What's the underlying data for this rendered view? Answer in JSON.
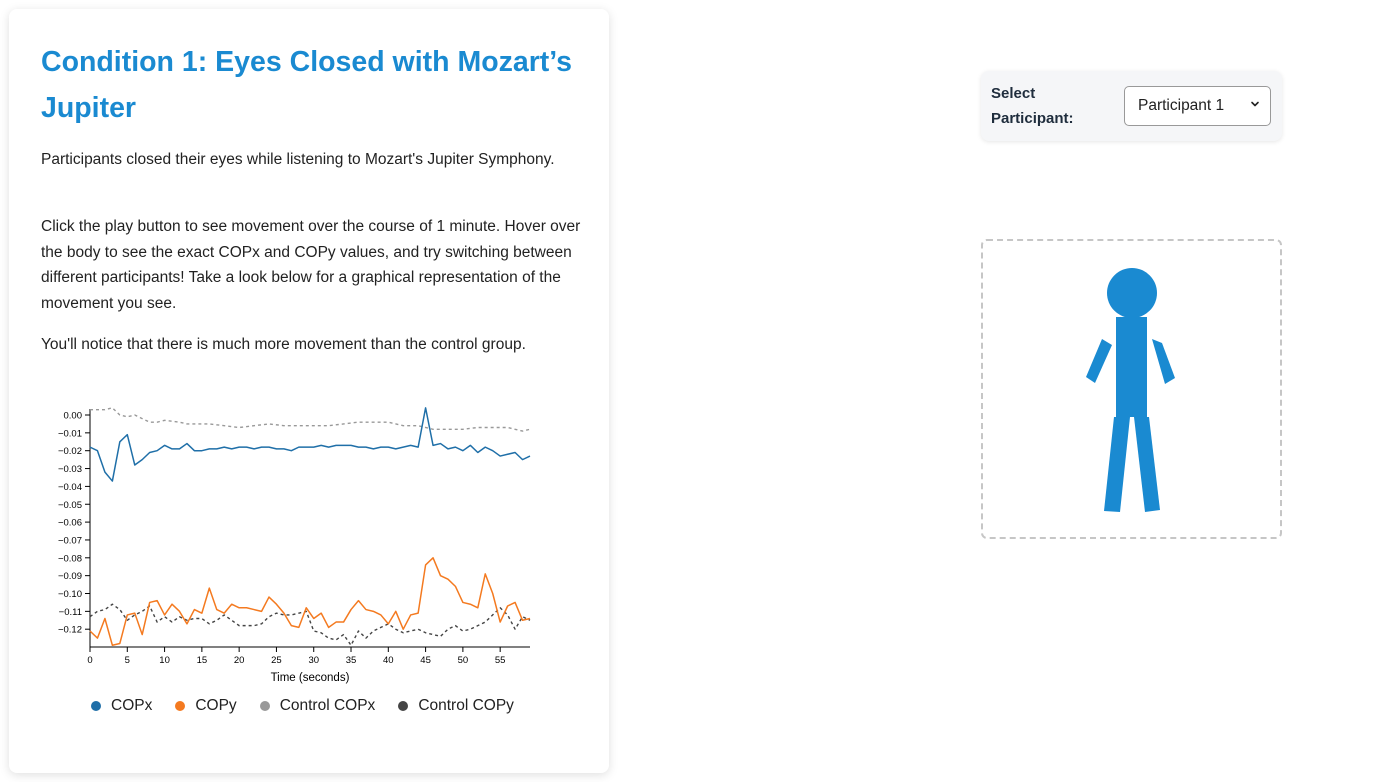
{
  "card": {
    "title": "Condition 1: Eyes Closed with Mozart’s Jupiter",
    "paragraphs": [
      "Participants closed their eyes while listening to Mozart's Jupiter Symphony.",
      "Click the play button to see movement over the course of 1 minute. Hover over the body to see the exact COPx and COPy values, and try switching between different participants! Take a look below for a graphical representation of the movement you see.",
      "You'll notice that there is much more movement than the control group."
    ]
  },
  "selector": {
    "label": "Select Participant:",
    "value": "Participant 1"
  },
  "figure": {
    "color": "#1a8ad1"
  },
  "chart_data": {
    "type": "line",
    "xlabel": "Time (seconds)",
    "ylabel": "",
    "xlim": [
      0,
      59
    ],
    "ylim": [
      -0.13,
      0.0
    ],
    "x_ticks": [
      0,
      5,
      10,
      15,
      20,
      25,
      30,
      35,
      40,
      45,
      50,
      55
    ],
    "y_ticks": [
      0.0,
      -0.01,
      -0.02,
      -0.03,
      -0.04,
      -0.05,
      -0.06,
      -0.07,
      -0.08,
      -0.09,
      -0.1,
      -0.11,
      -0.12
    ],
    "y_tick_labels": [
      "0.00",
      "−0.01",
      "−0.02",
      "−0.03",
      "−0.04",
      "−0.05",
      "−0.06",
      "−0.07",
      "−0.08",
      "−0.09",
      "−0.10",
      "−0.11",
      "−0.12"
    ],
    "series": [
      {
        "name": "COPx",
        "color": "#1f6fa8",
        "dashed": false,
        "x": [
          0,
          1,
          2,
          3,
          4,
          5,
          6,
          7,
          8,
          9,
          10,
          11,
          12,
          13,
          14,
          15,
          16,
          17,
          18,
          19,
          20,
          21,
          22,
          23,
          24,
          25,
          26,
          27,
          28,
          29,
          30,
          31,
          32,
          33,
          34,
          35,
          36,
          37,
          38,
          39,
          40,
          41,
          42,
          43,
          44,
          45,
          46,
          47,
          48,
          49,
          50,
          51,
          52,
          53,
          54,
          55,
          56,
          57,
          58,
          59
        ],
        "y": [
          -0.018,
          -0.02,
          -0.032,
          -0.037,
          -0.015,
          -0.011,
          -0.028,
          -0.025,
          -0.021,
          -0.02,
          -0.017,
          -0.019,
          -0.019,
          -0.016,
          -0.02,
          -0.02,
          -0.019,
          -0.019,
          -0.018,
          -0.019,
          -0.018,
          -0.018,
          -0.019,
          -0.018,
          -0.018,
          -0.019,
          -0.019,
          -0.02,
          -0.018,
          -0.018,
          -0.018,
          -0.017,
          -0.018,
          -0.017,
          -0.017,
          -0.017,
          -0.018,
          -0.018,
          -0.019,
          -0.018,
          -0.018,
          -0.019,
          -0.018,
          -0.017,
          -0.018,
          0.004,
          -0.017,
          -0.016,
          -0.019,
          -0.018,
          -0.02,
          -0.017,
          -0.021,
          -0.018,
          -0.02,
          -0.023,
          -0.022,
          -0.021,
          -0.025,
          -0.023
        ]
      },
      {
        "name": "COPy",
        "color": "#f47a20",
        "dashed": false,
        "x": [
          0,
          1,
          2,
          3,
          4,
          5,
          6,
          7,
          8,
          9,
          10,
          11,
          12,
          13,
          14,
          15,
          16,
          17,
          18,
          19,
          20,
          21,
          22,
          23,
          24,
          25,
          26,
          27,
          28,
          29,
          30,
          31,
          32,
          33,
          34,
          35,
          36,
          37,
          38,
          39,
          40,
          41,
          42,
          43,
          44,
          45,
          46,
          47,
          48,
          49,
          50,
          51,
          52,
          53,
          54,
          55,
          56,
          57,
          58,
          59
        ],
        "y": [
          -0.121,
          -0.125,
          -0.114,
          -0.129,
          -0.128,
          -0.112,
          -0.111,
          -0.123,
          -0.105,
          -0.104,
          -0.112,
          -0.106,
          -0.11,
          -0.117,
          -0.109,
          -0.111,
          -0.097,
          -0.109,
          -0.111,
          -0.106,
          -0.108,
          -0.108,
          -0.109,
          -0.11,
          -0.102,
          -0.106,
          -0.111,
          -0.118,
          -0.119,
          -0.108,
          -0.114,
          -0.111,
          -0.119,
          -0.116,
          -0.116,
          -0.109,
          -0.104,
          -0.109,
          -0.11,
          -0.112,
          -0.117,
          -0.11,
          -0.12,
          -0.112,
          -0.111,
          -0.084,
          -0.08,
          -0.09,
          -0.092,
          -0.096,
          -0.105,
          -0.106,
          -0.108,
          -0.089,
          -0.1,
          -0.116,
          -0.107,
          -0.105,
          -0.115,
          -0.114
        ]
      },
      {
        "name": "Control COPx",
        "color": "#999999",
        "dashed": true,
        "x": [
          0,
          2,
          3,
          4,
          5,
          6,
          7,
          8,
          9,
          10,
          12,
          13,
          14,
          16,
          18,
          20,
          22,
          24,
          26,
          28,
          30,
          32,
          34,
          36,
          38,
          40,
          42,
          44,
          46,
          48,
          50,
          52,
          54,
          56,
          58,
          59
        ],
        "y": [
          0.003,
          0.003,
          0.004,
          0.0,
          -0.001,
          0.0,
          -0.002,
          -0.004,
          -0.004,
          -0.003,
          -0.004,
          -0.005,
          -0.005,
          -0.005,
          -0.006,
          -0.007,
          -0.006,
          -0.005,
          -0.006,
          -0.006,
          -0.006,
          -0.006,
          -0.005,
          -0.004,
          -0.004,
          -0.004,
          -0.006,
          -0.006,
          -0.008,
          -0.008,
          -0.008,
          -0.007,
          -0.007,
          -0.007,
          -0.009,
          -0.008
        ]
      },
      {
        "name": "Control COPy",
        "color": "#444444",
        "dashed": true,
        "x": [
          0,
          1,
          2,
          3,
          4,
          5,
          6,
          7,
          8,
          9,
          10,
          11,
          12,
          13,
          14,
          15,
          16,
          17,
          18,
          19,
          20,
          21,
          22,
          23,
          24,
          25,
          26,
          27,
          28,
          29,
          30,
          31,
          32,
          33,
          34,
          35,
          36,
          37,
          38,
          39,
          40,
          41,
          42,
          43,
          44,
          45,
          46,
          47,
          48,
          49,
          50,
          51,
          52,
          53,
          54,
          55,
          56,
          57,
          58,
          59
        ],
        "y": [
          -0.113,
          -0.11,
          -0.109,
          -0.106,
          -0.109,
          -0.115,
          -0.112,
          -0.11,
          -0.107,
          -0.116,
          -0.113,
          -0.116,
          -0.113,
          -0.115,
          -0.114,
          -0.114,
          -0.117,
          -0.115,
          -0.112,
          -0.115,
          -0.118,
          -0.118,
          -0.118,
          -0.117,
          -0.113,
          -0.111,
          -0.112,
          -0.112,
          -0.111,
          -0.11,
          -0.121,
          -0.122,
          -0.125,
          -0.126,
          -0.123,
          -0.129,
          -0.121,
          -0.125,
          -0.121,
          -0.119,
          -0.117,
          -0.12,
          -0.122,
          -0.121,
          -0.12,
          -0.122,
          -0.123,
          -0.124,
          -0.12,
          -0.118,
          -0.121,
          -0.12,
          -0.118,
          -0.116,
          -0.112,
          -0.108,
          -0.112,
          -0.12,
          -0.113,
          -0.115
        ]
      }
    ],
    "legend_position": "bottom"
  }
}
